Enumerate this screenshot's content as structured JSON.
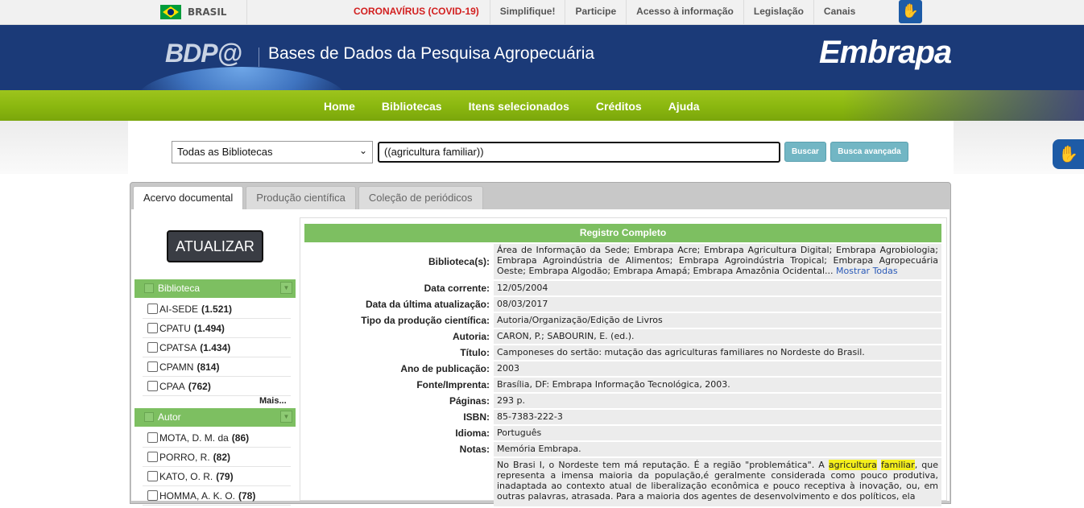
{
  "govbar": {
    "country": "BRASIL",
    "links": [
      "CORONAVÍRUS (COVID-19)",
      "Simplifique!",
      "Participe",
      "Acesso à informação",
      "Legislação",
      "Canais"
    ]
  },
  "header": {
    "logo": "BDP@",
    "title": "Bases de Dados da Pesquisa Agropecuária",
    "brand": "Embrapa"
  },
  "nav": [
    "Home",
    "Bibliotecas",
    "Itens selecionados",
    "Créditos",
    "Ajuda"
  ],
  "search": {
    "library_select": "Todas as Bibliotecas",
    "query": "((agricultura familiar))",
    "buscar": "Buscar",
    "avancada": "Busca avançada"
  },
  "tabs": [
    "Acervo documental",
    "Produção científica",
    "Coleção de periódicos"
  ],
  "sidebar": {
    "update_button": "ATUALIZAR",
    "biblioteca": {
      "title": "Biblioteca",
      "items": [
        {
          "label": "AI-SEDE",
          "count": "(1.521)"
        },
        {
          "label": "CPATU",
          "count": "(1.494)"
        },
        {
          "label": "CPATSA",
          "count": "(1.434)"
        },
        {
          "label": "CPAMN",
          "count": "(814)"
        },
        {
          "label": "CPAA",
          "count": "(762)"
        }
      ],
      "more": "Mais..."
    },
    "autor": {
      "title": "Autor",
      "items": [
        {
          "label": "MOTA, D. M. da",
          "count": "(86)"
        },
        {
          "label": "PORRO, R.",
          "count": "(82)"
        },
        {
          "label": "KATO, O. R.",
          "count": "(79)"
        },
        {
          "label": "HOMMA, A. K. O.",
          "count": "(78)"
        }
      ]
    }
  },
  "record": {
    "title": "Registro Completo",
    "biblioteca_label": "Biblioteca(s):",
    "biblioteca_value": "Área de Informação da Sede; Embrapa Acre; Embrapa Agricultura Digital; Embrapa Agrobiologia; Embrapa Agroindústria de Alimentos; Embrapa Agroindústria Tropical; Embrapa Agropecuária Oeste; Embrapa Algodão; Embrapa Amapá; Embrapa Amazônia Ocidental...",
    "mostrar_todas": "Mostrar Todas",
    "fields": [
      {
        "label": "Data corrente:",
        "value": "12/05/2004"
      },
      {
        "label": "Data da última atualização:",
        "value": "08/03/2017"
      },
      {
        "label": "Tipo da produção científica:",
        "value": "Autoria/Organização/Edição de Livros"
      },
      {
        "label": "Autoria:",
        "value": "CARON, P.; SABOURIN, E. (ed.)."
      },
      {
        "label": "Título:",
        "value": "Camponeses do sertão: mutação das agriculturas familiares no Nordeste do Brasil."
      },
      {
        "label": "Ano de publicação:",
        "value": "2003"
      },
      {
        "label": "Fonte/Imprenta:",
        "value": "Brasília, DF: Embrapa Informação Tecnológica, 2003."
      },
      {
        "label": "Páginas:",
        "value": "293 p."
      },
      {
        "label": "ISBN:",
        "value": "85-7383-222-3"
      },
      {
        "label": "Idioma:",
        "value": "Português"
      },
      {
        "label": "Notas:",
        "value": "Memória Embrapa."
      }
    ],
    "abstract_before": "No Brasi I, o Nordeste tem má reputação. É a região \"problemática\". A ",
    "abstract_hl1": "agricultura",
    "abstract_hl2": "familiar",
    "abstract_after": ", que representa a imensa maioria da população,é geralmente considerada como pouco produtiva, inadaptada ao contexto atual de liberalização econômica e pouco receptiva à inovação, ou, em outras palavras, atrasada. Para a maioria dos agentes de desenvolvimento e dos políticos, ela"
  }
}
